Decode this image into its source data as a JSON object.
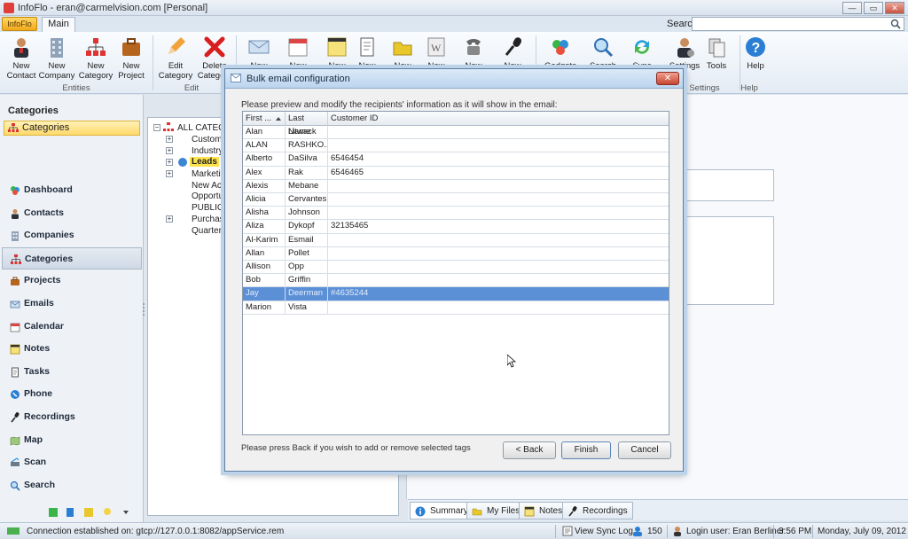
{
  "window": {
    "title": "InfoFlo - eran@carmelvision.com [Personal]",
    "min": "—",
    "max": "▭",
    "close": "✕"
  },
  "tabs": {
    "app_menu": "InfoFlo",
    "main": "Main"
  },
  "search": {
    "label": "Search",
    "value": ""
  },
  "ribbon": {
    "entities": [
      "New Contact",
      "New Company",
      "New Category",
      "New Project"
    ],
    "entities_label": "Entities",
    "edit": [
      "Edit Category",
      "Delete Category"
    ],
    "edit_label": "Edit",
    "create": [
      "New",
      "New",
      "New",
      "New",
      "New",
      "New",
      "New",
      "New"
    ],
    "misc": [
      "Gadgets",
      "Search",
      "Sync",
      "Settings",
      "Tools",
      "Help"
    ],
    "settings_label": "& Settings",
    "help_label": "Help"
  },
  "left_pane": {
    "header": "Categories",
    "selected": "Categories",
    "nav": [
      "Dashboard",
      "Contacts",
      "Companies",
      "Categories",
      "Projects",
      "Emails",
      "Calendar",
      "Notes",
      "Tasks",
      "Phone",
      "Recordings",
      "Map",
      "Scan",
      "Search"
    ]
  },
  "tree": {
    "root": "ALL CATEGOR",
    "items": [
      "Customer",
      "Industry",
      "Leads",
      "Marketing",
      "New Acco",
      "Opportun",
      "PUBLIC",
      "Purchase",
      "Quarterly"
    ]
  },
  "bottom_tabs": [
    "Summary",
    "My Files",
    "Notes",
    "Recordings"
  ],
  "status": {
    "connection": "Connection established on: gtcp://127.0.0.1:8082/appService.rem",
    "sync_log": "View Sync Log",
    "count": "150",
    "login": "Login user: Eran Berliner",
    "time": "3:56 PM",
    "date": "Monday, July 09, 2012"
  },
  "dialog": {
    "title": "Bulk email configuration",
    "close": "✕",
    "instruction": "Please preview and modify the recipients' information as it will show in the email:",
    "columns": [
      "First ...",
      "Last Name",
      "Customer ID"
    ],
    "rows": [
      [
        "Alan",
        "Litwack",
        ""
      ],
      [
        "ALAN",
        "RASHKO...",
        ""
      ],
      [
        "Alberto",
        "DaSilva",
        "6546454"
      ],
      [
        "Alex",
        "Rak",
        "6546465"
      ],
      [
        "Alexis",
        "Mebane",
        ""
      ],
      [
        "Alicia",
        "Cervantes",
        ""
      ],
      [
        "Alisha",
        "Johnson",
        ""
      ],
      [
        "Aliza",
        "Dykopf",
        "32135465"
      ],
      [
        "Al-Karim",
        "Esmail",
        ""
      ],
      [
        "Allan",
        "Pollet",
        ""
      ],
      [
        "Allison",
        "Opp",
        ""
      ],
      [
        "Bob",
        "Griffin",
        ""
      ],
      [
        "Jay",
        "Deerman",
        "#4635244"
      ],
      [
        "Marion",
        "Vista",
        ""
      ]
    ],
    "selected_row": 12,
    "footer_text": "Please press Back if you wish to add or remove selected tags",
    "buttons": {
      "back": "< Back",
      "finish": "Finish",
      "cancel": "Cancel"
    }
  }
}
